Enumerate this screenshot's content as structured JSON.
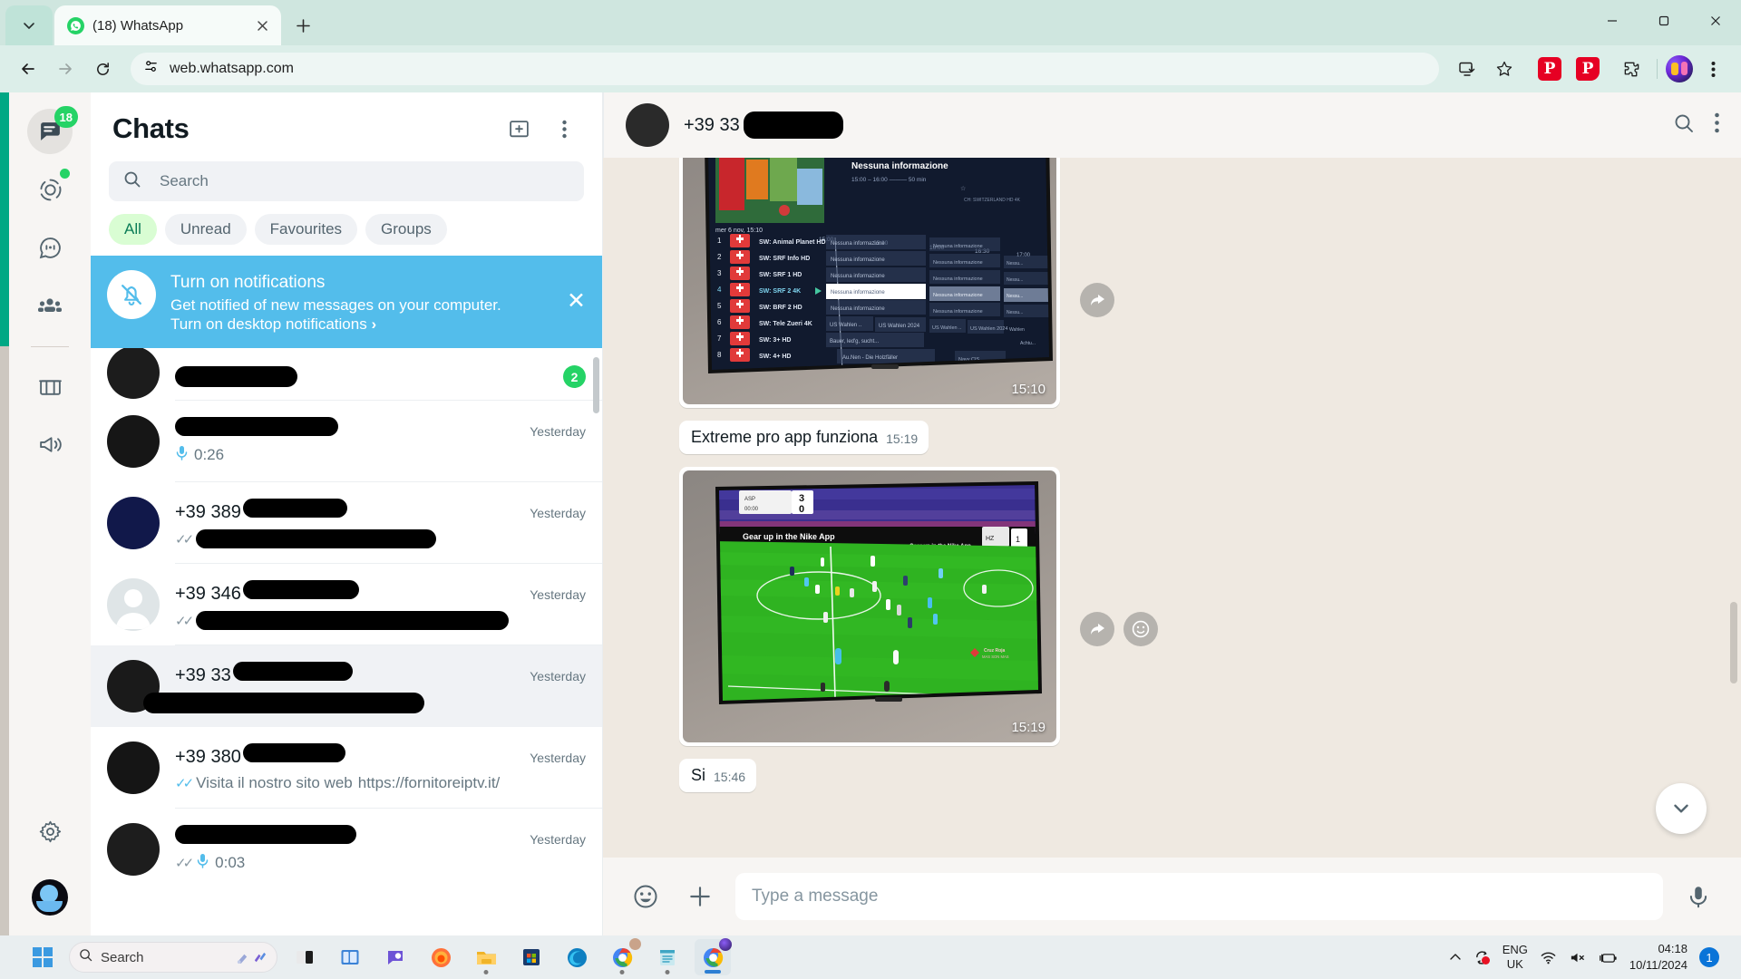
{
  "browser": {
    "tab": {
      "title": "(18) WhatsApp",
      "favicon": "whatsapp-icon"
    },
    "newtab_label": "+",
    "window_controls": {
      "minimize": "–",
      "maximize": "□",
      "close": "✕"
    },
    "address": "web.whatsapp.com",
    "toolbar_icons": [
      "back-icon",
      "forward-icon",
      "reload-icon",
      "site-info-icon",
      "install-icon",
      "bookmark-star-icon",
      "pinterest-extension-icon",
      "pinterest-save-icon",
      "extensions-puzzle-icon",
      "profile-avatar",
      "browser-menu-icon"
    ],
    "extension_letters": {
      "pinterest": "P",
      "pinterest_save": "P"
    }
  },
  "rail": {
    "items": [
      {
        "name": "chats",
        "icon": "chats-icon",
        "badge": "18",
        "active": true
      },
      {
        "name": "status",
        "icon": "status-icon",
        "dot": true
      },
      {
        "name": "channels",
        "icon": "channels-icon"
      },
      {
        "name": "communities",
        "icon": "communities-icon"
      },
      {
        "name": "archived",
        "icon": "archived-icon"
      },
      {
        "name": "broadcast",
        "icon": "broadcast-icon"
      }
    ],
    "settings": "settings-gear-icon",
    "profile": "profile-avatar"
  },
  "chatlist": {
    "title": "Chats",
    "new_chat_label": "new-chat-icon",
    "menu_label": "menu-icon",
    "search": {
      "placeholder": "Search",
      "icon": "search-icon"
    },
    "filters": [
      {
        "label": "All",
        "active": true
      },
      {
        "label": "Unread",
        "active": false
      },
      {
        "label": "Favourites",
        "active": false
      },
      {
        "label": "Groups",
        "active": false
      }
    ],
    "notification_banner": {
      "icon": "bell-off-icon",
      "title": "Turn on notifications",
      "subtitle": "Get notified of new messages on your computer.",
      "action": "Turn on desktop notifications",
      "action_chevron": "›",
      "close": "✕"
    },
    "rows": [
      {
        "name_redacted": true,
        "name": "",
        "name_w": 135,
        "time": "",
        "msg": "",
        "msg_redacted": true,
        "msg_w": 0,
        "unread": "2",
        "ticks": "",
        "mic": false,
        "avatar": "#1c1c1c",
        "partial": true
      },
      {
        "name_redacted": true,
        "name": "",
        "name_w": 180,
        "time": "Yesterday",
        "msg": "0:26",
        "msg_redacted": false,
        "msg_w": 0,
        "unread": "",
        "ticks": "",
        "mic": true,
        "avatar": "#161616"
      },
      {
        "name_redacted": true,
        "name": "+39 389",
        "name_w": 115,
        "time": "Yesterday",
        "msg": "",
        "msg_redacted": true,
        "msg_w": 265,
        "unread": "",
        "ticks": "✓✓",
        "tick_color": "grey",
        "mic": false,
        "avatar": "#11184a"
      },
      {
        "name_redacted": true,
        "name": "+39 346",
        "name_w": 128,
        "time": "Yesterday",
        "msg": "",
        "msg_redacted": true,
        "msg_w": 345,
        "unread": "",
        "ticks": "✓✓",
        "tick_color": "grey",
        "mic": false,
        "avatar": "#dfe5e7"
      },
      {
        "name_redacted": true,
        "name": "+39 33",
        "name_w": 132,
        "time": "Yesterday",
        "msg": "",
        "msg_redacted": true,
        "msg_w": 310,
        "unread": "",
        "ticks": "",
        "mic": false,
        "avatar": "#1a1a1a",
        "selected": true
      },
      {
        "name_redacted": true,
        "name": "+39 380",
        "name_w": 113,
        "time": "Yesterday",
        "msg": "Visita il nostro sito web",
        "link": "https://fornitoreiptv.it/",
        "msg_redacted": false,
        "msg_w": 0,
        "unread": "",
        "ticks": "✓✓",
        "tick_color": "blue",
        "mic": false,
        "avatar": "#151515"
      },
      {
        "name_redacted": true,
        "name": "",
        "name_w": 200,
        "time": "Yesterday",
        "msg": "0:03",
        "msg_redacted": false,
        "msg_w": 0,
        "unread": "",
        "ticks": "✓✓",
        "tick_color": "grey",
        "mic": true,
        "avatar": "#1d1d1d",
        "partial_bottom": true
      }
    ]
  },
  "conversation": {
    "header": {
      "contact_prefix": "+39 33",
      "redacted": true,
      "search_icon": "search-icon",
      "menu_icon": "menu-icon"
    },
    "messages": [
      {
        "type": "image",
        "kind": "tv-epg-photo",
        "time": "15:10",
        "actions": [
          "forward-icon"
        ],
        "photo_content": {
          "screen_title": "Nessuna informazione",
          "screen_subtitle": "15:00 – 16:00 —— 50 min",
          "screen_corner": "CH: SWITZERLAND HD 4K",
          "date_line": "mer 6 nov, 15:10",
          "timeline": [
            "15:00",
            "15:30",
            "16:00",
            "16:30",
            "17:00"
          ],
          "channels": [
            {
              "num": "1",
              "name": "SW: Animal Planet HD"
            },
            {
              "num": "2",
              "name": "SW: SRF Info HD"
            },
            {
              "num": "3",
              "name": "SW: SRF 1 HD"
            },
            {
              "num": "4",
              "name": "SW: SRF 2 4K",
              "selected": true
            },
            {
              "num": "5",
              "name": "SW: BRF 2 HD"
            },
            {
              "num": "6",
              "name": "SW: Tele Zueri 4K"
            },
            {
              "num": "7",
              "name": "SW: 3+ HD"
            },
            {
              "num": "8",
              "name": "SW: 4+ HD"
            }
          ],
          "programmes": [
            "Nessuna informazione",
            "US Wahlen 2024",
            "Bauer, ledig, sucht...",
            "Aushen - Die Hoizfäller",
            "Navy CIS"
          ]
        }
      },
      {
        "type": "text",
        "text": "Extreme pro app funziona",
        "time": "15:19"
      },
      {
        "type": "image",
        "kind": "tv-football-photo",
        "time": "15:19",
        "actions": [
          "forward-icon",
          "react-emoji-icon"
        ],
        "photo_content": {
          "score": "3 - 0",
          "clock": "00:00",
          "banner": "Gear up in the Nike App",
          "banner2": "Gear up in the Nike App",
          "corner_logo": "Cruz Roja"
        }
      },
      {
        "type": "text",
        "text": "Si",
        "time": "15:46"
      }
    ],
    "scroll_down_icon": "chevron-down-icon",
    "composer": {
      "emoji_icon": "emoji-icon",
      "attach_icon": "plus-icon",
      "placeholder": "Type a message",
      "mic_icon": "microphone-icon"
    }
  },
  "taskbar": {
    "start_label": "start-icon",
    "search": {
      "placeholder": "Search",
      "icon": "search-icon",
      "widgets": [
        "copilot-icon",
        "sparkle-icon"
      ]
    },
    "apps": [
      {
        "name": "task-view",
        "running": false
      },
      {
        "name": "widgets",
        "running": false
      },
      {
        "name": "teams-chat",
        "running": false
      },
      {
        "name": "firefox",
        "running": false
      },
      {
        "name": "file-explorer",
        "running": true
      },
      {
        "name": "microsoft-store",
        "running": false
      },
      {
        "name": "microsoft-edge",
        "running": false
      },
      {
        "name": "chrome-profile",
        "running": true
      },
      {
        "name": "notepad",
        "running": true
      },
      {
        "name": "chrome-whatsapp",
        "running": true,
        "active": true
      }
    ],
    "tray": {
      "overflow": "^",
      "sync_icon": "sync-icon",
      "language": {
        "line1": "ENG",
        "line2": "UK"
      },
      "wifi_icon": "wifi-icon",
      "volume_icon": "volume-muted-icon",
      "battery_icon": "battery-charging-icon",
      "time": "04:18",
      "date": "10/11/2024",
      "notification_count": "1"
    }
  },
  "colors": {
    "whatsapp_green": "#00a884",
    "accent_blue": "#53bdeb",
    "unread_badge": "#25d366",
    "chat_bg": "#efe9e1",
    "banner_blue": "#53bdeb"
  }
}
